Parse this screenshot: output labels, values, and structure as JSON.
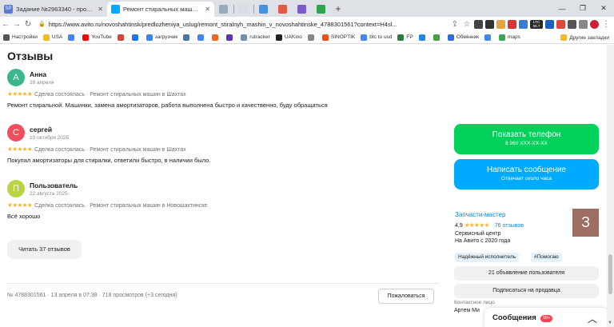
{
  "browser": {
    "tabs": [
      {
        "label": "Задание №2963340 - просмотр з",
        "icon": "sp-icon",
        "fav_text": "SP",
        "fav_color": "#5a7bd5",
        "active": false
      },
      {
        "label": "Ремонт стиральных машин в Нов",
        "icon": "avito-icon",
        "fav_text": "",
        "fav_color": "#00aaff",
        "active": true
      }
    ],
    "url": "https://www.avito.ru/novoshahtinsk/predlozheniya_uslug/remont_stiralnyh_mashin_v_novoshahtinske_4788301561?context=H4sl...",
    "ltc": {
      "label": "LTC",
      "value": "56.7"
    },
    "bookmarks": [
      "Настройки",
      "USA",
      "",
      "YouTube",
      "",
      "",
      "загрузчик",
      "",
      "",
      "",
      "",
      "rutracker",
      "UAKino",
      "",
      "SINOPTIK",
      "btc to usd",
      "FP",
      "",
      "",
      "Обмінник",
      "",
      "maps"
    ],
    "bookmarks_right": "Другие закладки"
  },
  "page": {
    "title": "Отзывы",
    "reviews": [
      {
        "initial": "А",
        "avatar_color": "#3bb88a",
        "name": "Анна",
        "date": "29 апреля",
        "stars": "★★★★★",
        "meta": "Сделка состоялась · Ремонт стиральных машин в Шахтах",
        "text": "Ремонт стиральной. Машинки, замена амортизаторов, работа выполнена быстро и качественно, буду обращаться"
      },
      {
        "initial": "С",
        "avatar_color": "#ef4e5e",
        "name": "сергей",
        "date": "10 октября 2025",
        "stars": "★★★★★",
        "meta": "Сделка состоялась · Ремонт стиральных машин в Шахтах",
        "text": "Покупал амортизаторы для стиралки, ответили быстро, в наличии было."
      },
      {
        "initial": "П",
        "avatar_color": "#b8d444",
        "name": "Пользователь",
        "date": "22 августа 2025",
        "stars": "★★★★★",
        "meta": "Сделка состоялась · Ремонт стиральных машин в Новошахтинске",
        "text": "Всё хорошо"
      }
    ],
    "more_reviews_label": "Читать 37 отзывов",
    "footer_info": "№ 4788301561 · 13 апреля в 07:38 · 718 просмотров (+3 сегодня)",
    "report_label": "Пожаловаться"
  },
  "sidebar": {
    "phone_button": {
      "label": "Показать телефон",
      "sub": "8 960 XXX-XX-XX"
    },
    "message_button": {
      "label": "Написать сообщение",
      "sub": "Отвечает около часа"
    },
    "seller": {
      "name": "Запчасти-мастер",
      "rating": "4,9",
      "stars": "★★★★★",
      "reviews": "76 отзывов",
      "type": "Сервисный центр",
      "since": "На Авито с 2020 года",
      "avatar_letter": "З"
    },
    "badges": [
      "Надёжный исполнитель",
      "#Помогаю"
    ],
    "all_ads_label": "21 объявление пользователя",
    "subscribe_label": "Подписаться на продавца",
    "contact_label": "Контактное лицо",
    "contact_name": "Артем Ми"
  },
  "messages_bar": {
    "label": "Сообщения",
    "count": "99+"
  }
}
